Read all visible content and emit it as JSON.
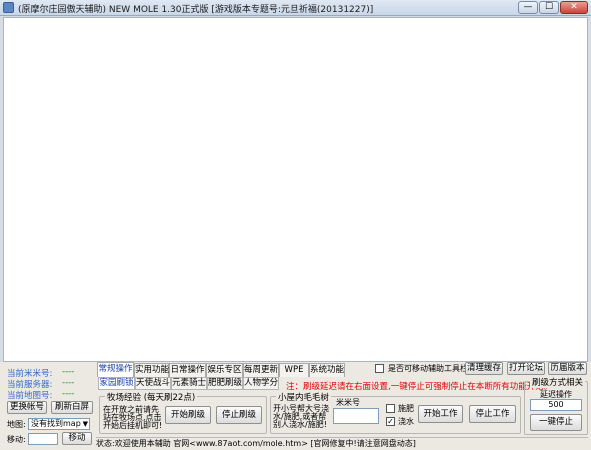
{
  "window": {
    "title": "(原摩尔庄园傲天辅助) NEW MOLE 1.30正式版 [游戏版本专题号:元旦祈福(20131227)]",
    "min_label": "—",
    "max_label": "☐",
    "close_label": "✕"
  },
  "left": {
    "mimi_label": "当前米米号:",
    "mimi_value": "----",
    "server_label": "当前服务器:",
    "server_value": "----",
    "map_label": "当前地图号:",
    "map_value": "----",
    "switch_account": "更换帐号",
    "refresh_screen": "刷新白屏",
    "map_select_label": "地图:",
    "map_select_value": "没有找到map",
    "move_label": "移动:",
    "move_button": "移动"
  },
  "tabs": [
    "常规操作",
    "实用功能",
    "日常操作",
    "娱乐专区",
    "每周更新",
    "WPE",
    "系统功能"
  ],
  "toolbar": {
    "movable_checkbox": "是否可移动辅助工具栏",
    "clear_cache": "清理缓存",
    "open_forum": "打开论坛",
    "history_version": "历届版本"
  },
  "subtabs": [
    "家园刷锁",
    "天使战斗",
    "元素骑士",
    "肥肥刷级",
    "人物学分"
  ],
  "notice": "注：刷级延迟请在右面设置,一键停止可强制停止在本断所有功能开始。",
  "farm": {
    "title": "牧场经验 (每天刷22点)",
    "desc_1": "在开放之前请先",
    "desc_2": "站在牧场点,点击",
    "desc_3": "开始后挂机即可!",
    "start": "开始刷级",
    "stop": "停止刷级"
  },
  "tree": {
    "title": "小屋内毛毛树",
    "desc_1": "开小号帮大号浇",
    "desc_2": "水/施肥,或者帮",
    "desc_3": "别人浇水/施肥!",
    "mimi_label": "米米号",
    "mimi_value": "",
    "fertilize_label": "施肥",
    "water_label": "浇水",
    "water_checked": "✓",
    "start": "开始工作",
    "stop": "停止工作"
  },
  "settings": {
    "title": "刷级方式相关",
    "delay_label": "延迟操作",
    "delay_value": "500",
    "stop_all": "一键停止"
  },
  "status": {
    "text": "状态:欢迎使用本辅助 官网<www.87aot.com/mole.htm> [官网修复中!请注意网盘动态]"
  }
}
